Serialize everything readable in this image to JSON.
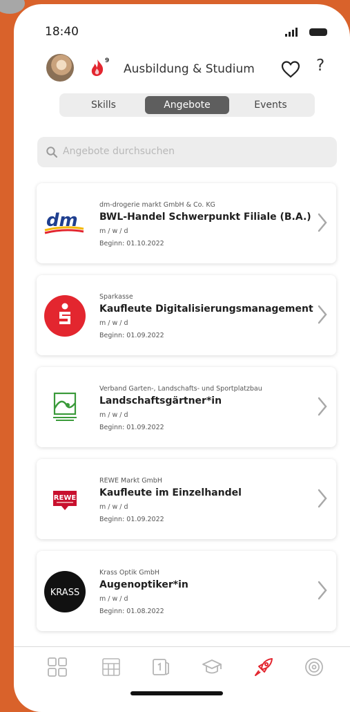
{
  "status_bar": {
    "time": "18:40"
  },
  "header": {
    "flame_count": "9",
    "title": "Ausbildung & Studium",
    "help_label": "?"
  },
  "tabs": [
    {
      "label": "Skills",
      "active": false
    },
    {
      "label": "Angebote",
      "active": true
    },
    {
      "label": "Events",
      "active": false
    }
  ],
  "search": {
    "placeholder": "Angebote durchsuchen"
  },
  "offers": [
    {
      "company": "dm-drogerie markt GmbH & Co. KG",
      "title": "BWL-Handel Schwerpunkt Filiale (B.A.)",
      "gender": "m / w / d",
      "start": "Beginn: 01.10.2022",
      "logo": "dm-logo",
      "logo_text": "dm"
    },
    {
      "company": "Sparkasse",
      "title": "Kaufleute Digitalisierungsmanagement",
      "gender": "m / w / d",
      "start": "Beginn: 01.09.2022",
      "logo": "sparkasse-logo",
      "logo_text": ""
    },
    {
      "company": "Verband Garten-, Landschafts- und Sportplatzbau",
      "title": "Landschaftsgärtner*in",
      "gender": "m / w / d",
      "start": "Beginn: 01.09.2022",
      "logo": "galabau-logo",
      "logo_text": ""
    },
    {
      "company": "REWE Markt GmbH",
      "title": "Kaufleute im Einzelhandel",
      "gender": "m / w / d",
      "start": "Beginn: 01.09.2022",
      "logo": "rewe-logo",
      "logo_text": "REWE"
    },
    {
      "company": "Krass Optik GmbH",
      "title": "Augenoptiker*in",
      "gender": "m / w / d",
      "start": "Beginn: 01.08.2022",
      "logo": "krass-logo",
      "logo_text": "KRASS"
    }
  ],
  "bottom_nav": [
    {
      "icon": "grid-icon",
      "active": false
    },
    {
      "icon": "calendar-icon",
      "active": false
    },
    {
      "icon": "card-icon",
      "active": false
    },
    {
      "icon": "graduation-cap-icon",
      "active": false
    },
    {
      "icon": "rocket-icon",
      "active": true
    },
    {
      "icon": "target-icon",
      "active": false
    }
  ],
  "colors": {
    "accent": "#e3262f",
    "background": "#d9622b",
    "tab_active": "#5e5e5e"
  }
}
